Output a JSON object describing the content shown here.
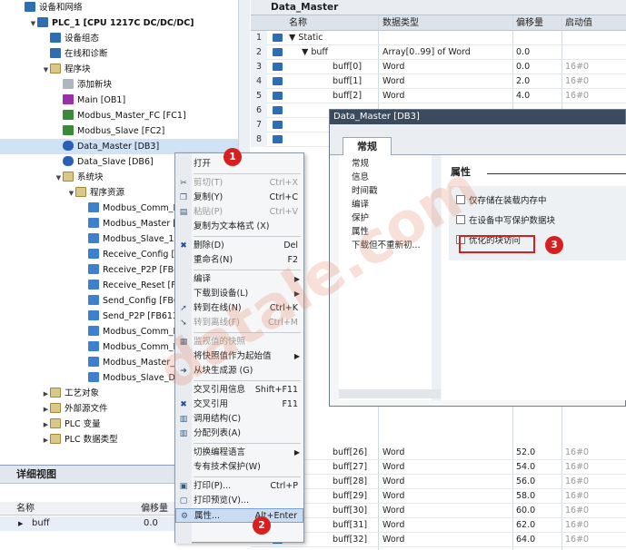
{
  "tree": {
    "items": [
      {
        "label": "设备和网络",
        "x": 0,
        "icon": "network-icon",
        "exp": ""
      },
      {
        "label": "PLC_1 [CPU 1217C DC/DC/DC]",
        "x": 1,
        "icon": "cpu-icon",
        "exp": "▼",
        "bold": true
      },
      {
        "label": "设备组态",
        "x": 2,
        "icon": "device-config-icon",
        "exp": ""
      },
      {
        "label": "在线和诊断",
        "x": 2,
        "icon": "online-diagnostics-icon",
        "exp": ""
      },
      {
        "label": "程序块",
        "x": 2,
        "icon": "folder-icon",
        "exp": "▼"
      },
      {
        "label": "添加新块",
        "x": 3,
        "icon": "add-block-icon",
        "exp": ""
      },
      {
        "label": "Main [OB1]",
        "x": 3,
        "icon": "ob-icon",
        "exp": ""
      },
      {
        "label": "Modbus_Master_FC [FC1]",
        "x": 3,
        "icon": "fc-icon",
        "exp": ""
      },
      {
        "label": "Modbus_Slave [FC2]",
        "x": 3,
        "icon": "fc-icon",
        "exp": ""
      },
      {
        "label": "Data_Master [DB3]",
        "x": 3,
        "icon": "db-icon",
        "exp": "",
        "sel": true
      },
      {
        "label": "Data_Slave [DB6]",
        "x": 3,
        "icon": "db-icon",
        "exp": ""
      },
      {
        "label": "系统块",
        "x": 3,
        "icon": "folder-icon",
        "exp": "▼"
      },
      {
        "label": "程序资源",
        "x": 4,
        "icon": "folder-icon",
        "exp": "▼"
      },
      {
        "label": "Modbus_Comm_L",
        "x": 5,
        "icon": "library-block-icon",
        "exp": ""
      },
      {
        "label": "Modbus_Master [",
        "x": 5,
        "icon": "library-block-icon",
        "exp": ""
      },
      {
        "label": "Modbus_Slave_1",
        "x": 5,
        "icon": "library-block-icon",
        "exp": ""
      },
      {
        "label": "Receive_Config [F",
        "x": 5,
        "icon": "library-block-icon",
        "exp": ""
      },
      {
        "label": "Receive_P2P [FB6",
        "x": 5,
        "icon": "library-block-icon",
        "exp": ""
      },
      {
        "label": "Receive_Reset [FB",
        "x": 5,
        "icon": "library-block-icon",
        "exp": ""
      },
      {
        "label": "Send_Config [FB6",
        "x": 5,
        "icon": "library-block-icon",
        "exp": ""
      },
      {
        "label": "Send_P2P [FB613",
        "x": 5,
        "icon": "library-block-icon",
        "exp": ""
      },
      {
        "label": "Modbus_Comm_L",
        "x": 5,
        "icon": "library-block-icon",
        "exp": ""
      },
      {
        "label": "Modbus_Comm_L",
        "x": 5,
        "icon": "library-block-icon",
        "exp": ""
      },
      {
        "label": "Modbus_Master_",
        "x": 5,
        "icon": "library-block-icon",
        "exp": ""
      },
      {
        "label": "Modbus_Slave_D",
        "x": 5,
        "icon": "library-block-icon",
        "exp": ""
      },
      {
        "label": "工艺对象",
        "x": 2,
        "icon": "folder-icon",
        "exp": "▶"
      },
      {
        "label": "外部源文件",
        "x": 2,
        "icon": "folder-icon",
        "exp": "▶"
      },
      {
        "label": "PLC 变量",
        "x": 2,
        "icon": "folder-icon",
        "exp": "▶"
      },
      {
        "label": "PLC 数据类型",
        "x": 2,
        "icon": "folder-icon",
        "exp": "▶"
      }
    ]
  },
  "detail": {
    "title": "详细视图",
    "col_name": "名称",
    "col_offset": "偏移量",
    "row_name": "buff",
    "row_offset": "0.0"
  },
  "editor": {
    "title": "Data_Master",
    "col_name": "名称",
    "col_type": "数据类型",
    "col_offset": "偏移量",
    "col_start": "启动值",
    "rows": [
      {
        "num": "1",
        "name": "▼ Static",
        "type": "",
        "offset": "",
        "start": ""
      },
      {
        "num": "2",
        "name": "▼ buff",
        "type": "Array[0..99] of Word",
        "offset": "0.0",
        "start": ""
      },
      {
        "num": "3",
        "name": "buff[0]",
        "type": "Word",
        "offset": "0.0",
        "start": "16#0"
      },
      {
        "num": "4",
        "name": "buff[1]",
        "type": "Word",
        "offset": "2.0",
        "start": "16#0"
      },
      {
        "num": "5",
        "name": "buff[2]",
        "type": "Word",
        "offset": "4.0",
        "start": "16#0"
      },
      {
        "num": "6",
        "name": "",
        "type": "",
        "offset": "",
        "start": ""
      },
      {
        "num": "7",
        "name": "",
        "type": "",
        "offset": "",
        "start": ""
      },
      {
        "num": "8",
        "name": "",
        "type": "",
        "offset": "",
        "start": ""
      }
    ],
    "bottom_rows": [
      {
        "name": "buff[26]",
        "type": "Word",
        "offset": "52.0",
        "start": "16#0"
      },
      {
        "name": "buff[27]",
        "type": "Word",
        "offset": "54.0",
        "start": "16#0"
      },
      {
        "name": "buff[28]",
        "type": "Word",
        "offset": "56.0",
        "start": "16#0"
      },
      {
        "name": "buff[29]",
        "type": "Word",
        "offset": "58.0",
        "start": "16#0"
      },
      {
        "name": "buff[30]",
        "type": "Word",
        "offset": "60.0",
        "start": "16#0"
      },
      {
        "name": "buff[31]",
        "type": "Word",
        "offset": "62.0",
        "start": "16#0"
      },
      {
        "name": "buff[32]",
        "type": "Word",
        "offset": "64.0",
        "start": "16#0"
      }
    ]
  },
  "dialog": {
    "title": "Data_Master [DB3]",
    "tab": "常规",
    "nav": [
      "常规",
      "信息",
      "时间戳",
      "编译",
      "保护",
      "属性",
      "下载但不重新初..."
    ],
    "pane_title": "属性",
    "options": [
      "仅存储在装载内存中",
      "在设备中写保护数据块",
      "优化的块访问"
    ]
  },
  "context_menu": {
    "items": [
      {
        "label": "打开",
        "shortcut": "",
        "icon": "",
        "disabled": false,
        "arrow": false
      },
      {
        "label": "剪切(T)",
        "shortcut": "Ctrl+X",
        "icon": "cut-icon",
        "disabled": true,
        "arrow": false
      },
      {
        "label": "复制(Y)",
        "shortcut": "Ctrl+C",
        "icon": "copy-icon",
        "disabled": false,
        "arrow": false
      },
      {
        "label": "粘贴(P)",
        "shortcut": "Ctrl+V",
        "icon": "paste-icon",
        "disabled": true,
        "arrow": false
      },
      {
        "label": "复制为文本格式 (X)",
        "shortcut": "",
        "icon": "",
        "disabled": false,
        "arrow": false
      },
      {
        "label": "删除(D)",
        "shortcut": "Del",
        "icon": "delete-icon",
        "disabled": false,
        "arrow": false
      },
      {
        "label": "重命名(N)",
        "shortcut": "F2",
        "icon": "",
        "disabled": false,
        "arrow": false
      },
      {
        "label": "编译",
        "shortcut": "",
        "icon": "",
        "disabled": false,
        "arrow": true
      },
      {
        "label": "下载到设备(L)",
        "shortcut": "",
        "icon": "",
        "disabled": false,
        "arrow": true
      },
      {
        "label": "转到在线(N)",
        "shortcut": "Ctrl+K",
        "icon": "go-online-icon",
        "disabled": false,
        "arrow": false
      },
      {
        "label": "转到离线(F)",
        "shortcut": "Ctrl+M",
        "icon": "go-offline-icon",
        "disabled": true,
        "arrow": false
      },
      {
        "label": "监视值的快照",
        "shortcut": "",
        "icon": "snapshot-icon",
        "disabled": true,
        "arrow": false
      },
      {
        "label": "将快照值作为起始值",
        "shortcut": "",
        "icon": "",
        "disabled": false,
        "arrow": true
      },
      {
        "label": "从块生成源 (G)",
        "shortcut": "",
        "icon": "generate-source-icon",
        "disabled": false,
        "arrow": false
      },
      {
        "label": "交叉引用信息",
        "shortcut": "Shift+F11",
        "icon": "",
        "disabled": false,
        "arrow": false
      },
      {
        "label": "交叉引用",
        "shortcut": "F11",
        "icon": "cross-reference-icon",
        "disabled": false,
        "arrow": false
      },
      {
        "label": "调用结构(C)",
        "shortcut": "",
        "icon": "call-structure-icon",
        "disabled": false,
        "arrow": false
      },
      {
        "label": "分配列表(A)",
        "shortcut": "",
        "icon": "assignment-list-icon",
        "disabled": false,
        "arrow": false
      },
      {
        "label": "切换编程语言",
        "shortcut": "",
        "icon": "",
        "disabled": false,
        "arrow": true
      },
      {
        "label": "专有技术保护(W)",
        "shortcut": "",
        "icon": "",
        "disabled": false,
        "arrow": false
      },
      {
        "label": "打印(P)...",
        "shortcut": "Ctrl+P",
        "icon": "print-icon",
        "disabled": false,
        "arrow": false
      },
      {
        "label": "打印预览(V)...",
        "shortcut": "",
        "icon": "print-preview-icon",
        "disabled": false,
        "arrow": false
      },
      {
        "label": "属性...",
        "shortcut": "Alt+Enter",
        "icon": "properties-icon",
        "disabled": false,
        "arrow": false,
        "highlight": true
      }
    ]
  },
  "badges": [
    "1",
    "2",
    "3"
  ],
  "watermark": "datale.com",
  "colors": {
    "accent": "#d81f1f",
    "selection": "#c9dcf2",
    "block_icon": "#2f6db3"
  }
}
